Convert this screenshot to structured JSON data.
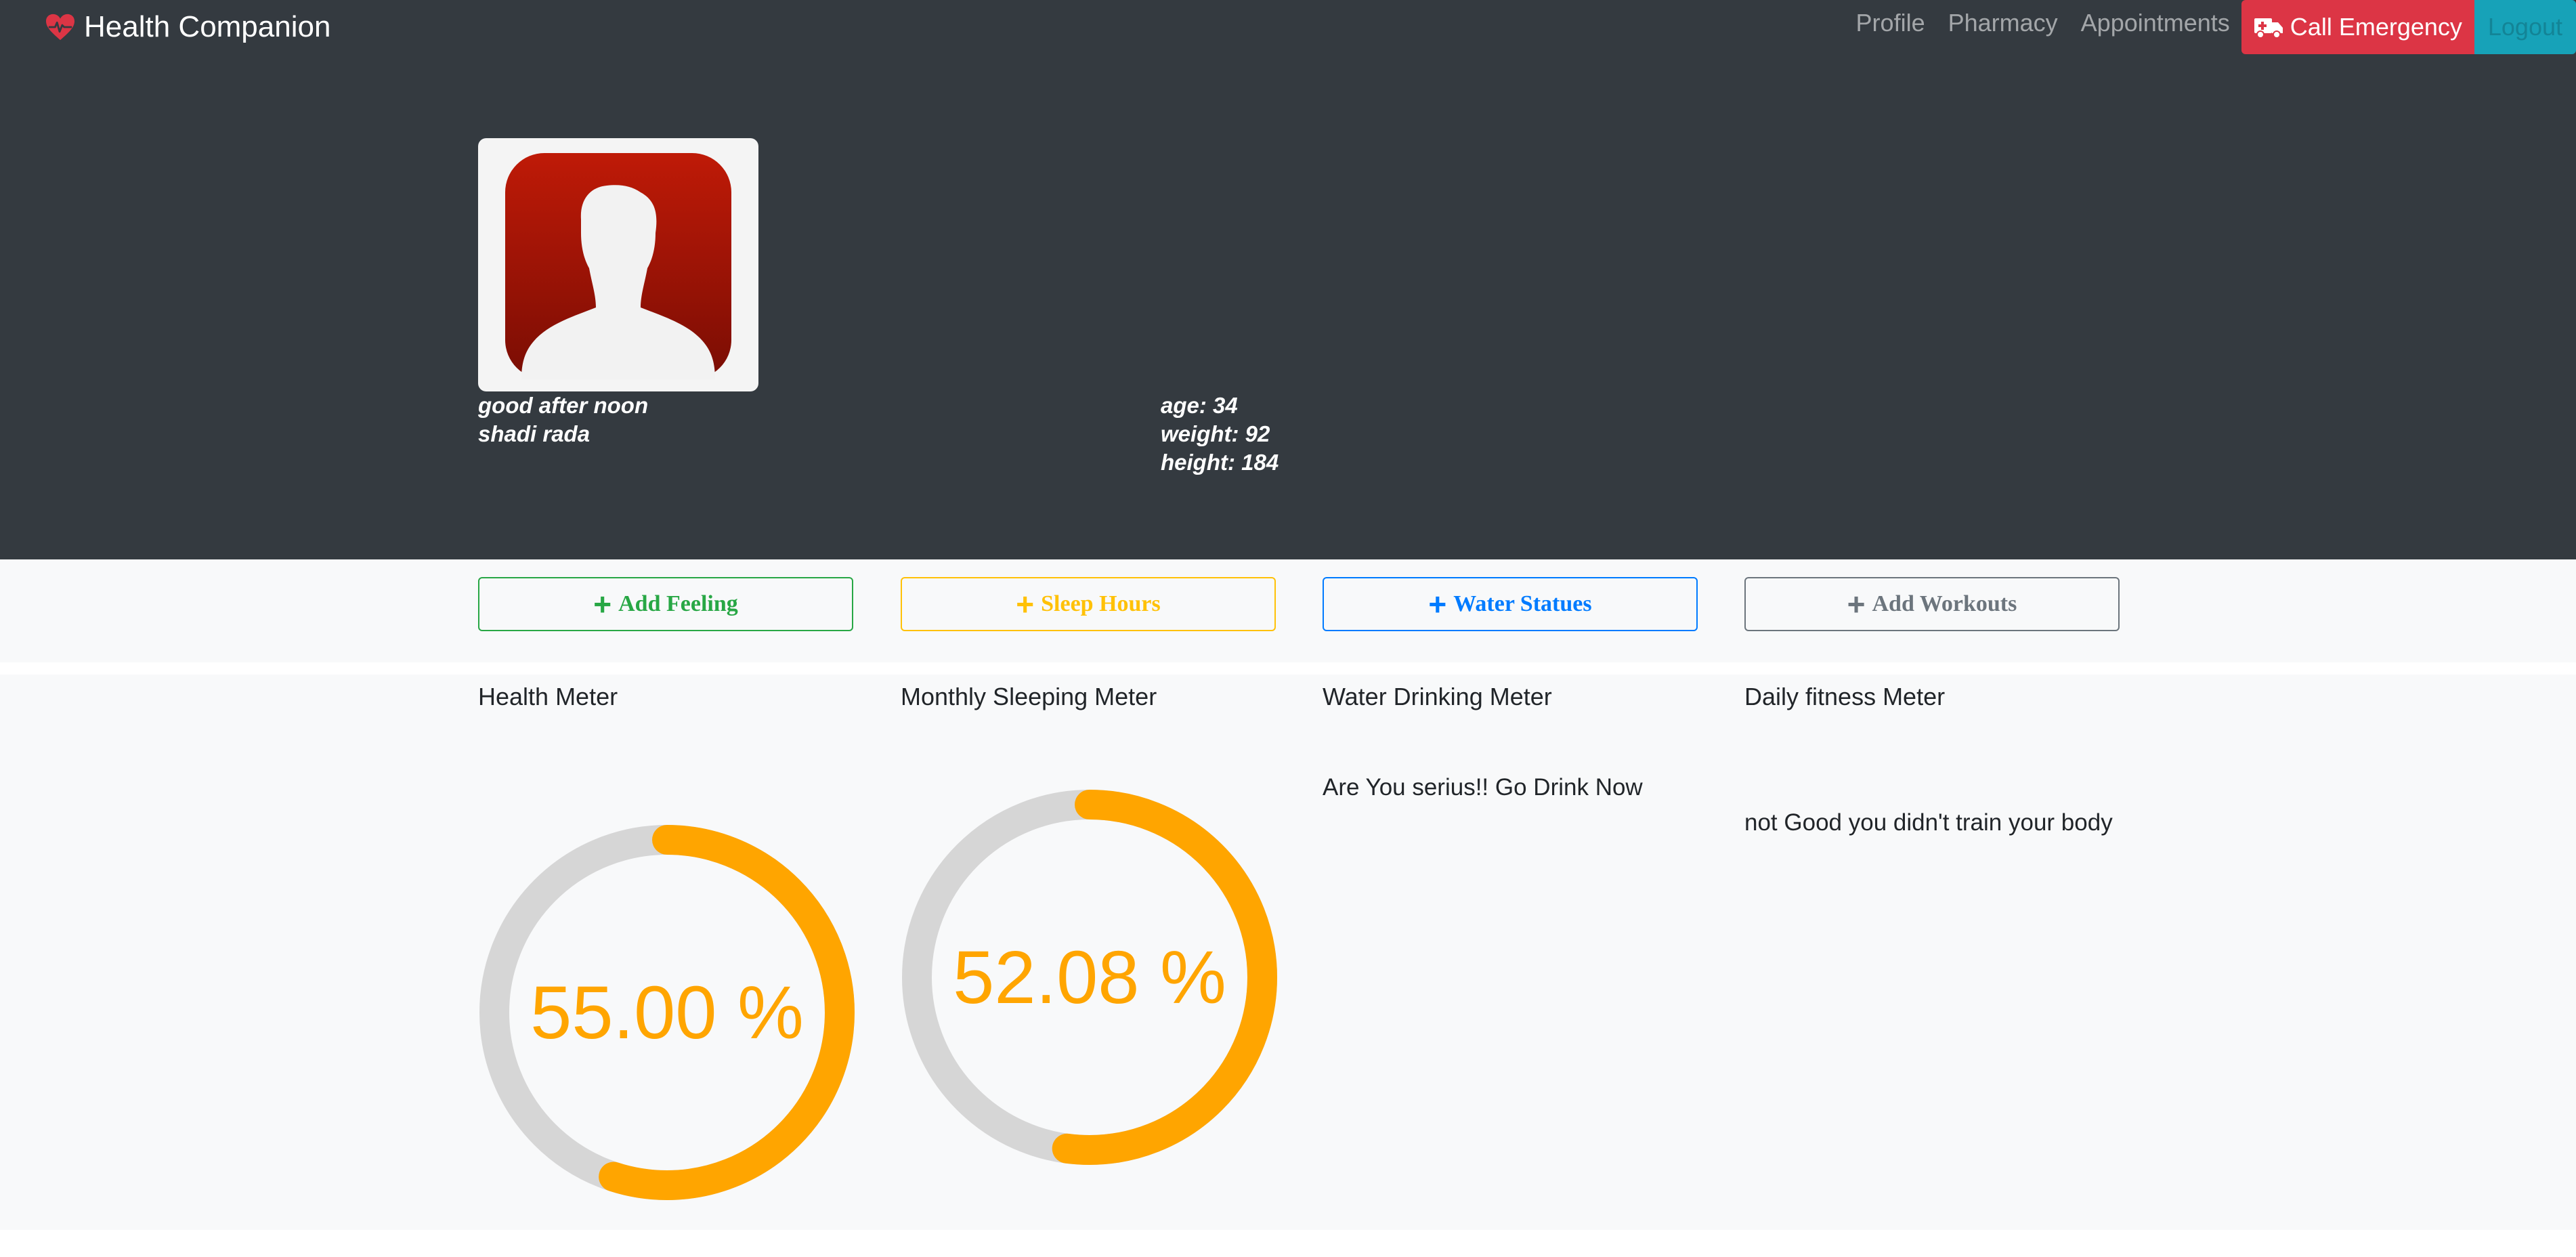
{
  "navbar": {
    "brand": "Health Companion",
    "links": [
      "Profile",
      "Pharmacy",
      "Appointments"
    ],
    "emergency_label": "Call Emergency",
    "logout_label": "Logout"
  },
  "profile": {
    "greeting": "good after noon",
    "name": "shadi rada",
    "age": "age: 34",
    "weight": "weight: 92",
    "height": "height: 184"
  },
  "actions": {
    "add_feeling": "Add Feeling",
    "sleep_hours": "Sleep Hours",
    "water_statues": "Water Statues",
    "add_workouts": "Add Workouts"
  },
  "meters": {
    "health": {
      "title": "Health Meter",
      "label": "55.00 %",
      "value": 0.55
    },
    "sleeping": {
      "title": "Monthly Sleeping Meter",
      "label": "52.08 %",
      "value": 0.5208
    },
    "water": {
      "title": "Water Drinking Meter",
      "message": "Are You serius!! Go Drink Now"
    },
    "fitness": {
      "title": "Daily fitness Meter",
      "message": "not Good you didn't train your body"
    }
  },
  "colors": {
    "navbar_bg": "#343a40",
    "gauge_fill": "#ffa500",
    "gauge_track": "#d6d6d6",
    "emergency": "#dc3545",
    "logout": "#17a2b8"
  }
}
